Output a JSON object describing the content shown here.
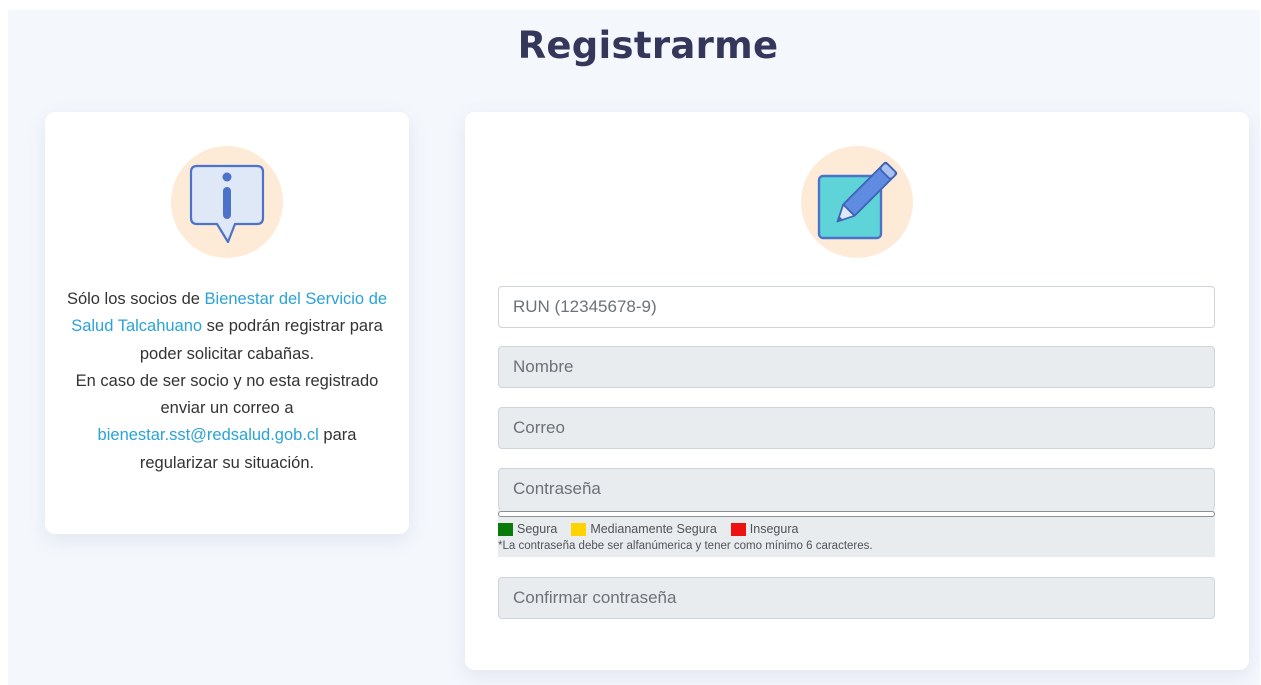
{
  "page": {
    "title": "Registrarme"
  },
  "info_card": {
    "icon": "info-speech-bubble-icon",
    "text_part1": "Sólo los socios de ",
    "link_org": "Bienestar del Servicio de Salud Talcahuano",
    "text_part2": " se podrán registrar para poder solicitar cabañas.",
    "text_part3": "En caso de ser socio y no esta registrado enviar un correo a ",
    "link_email": "bienestar.sst@redsalud.gob.cl",
    "text_part4": " para regularizar su situación."
  },
  "form": {
    "icon": "edit-pencil-icon",
    "run_placeholder": "RUN (12345678-9)",
    "nombre_placeholder": "Nombre",
    "correo_placeholder": "Correo",
    "password_placeholder": "Contraseña",
    "confirm_placeholder": "Confirmar contraseña",
    "strength": {
      "legend": [
        {
          "label": "Segura",
          "color": "#0a7a0a"
        },
        {
          "label": "Medianamente Segura",
          "color": "#ffd200"
        },
        {
          "label": "Insegura",
          "color": "#ee1111"
        }
      ],
      "note": "*La contraseña debe ser alfanúmerica y tener como mínimo 6 caracteres."
    }
  }
}
